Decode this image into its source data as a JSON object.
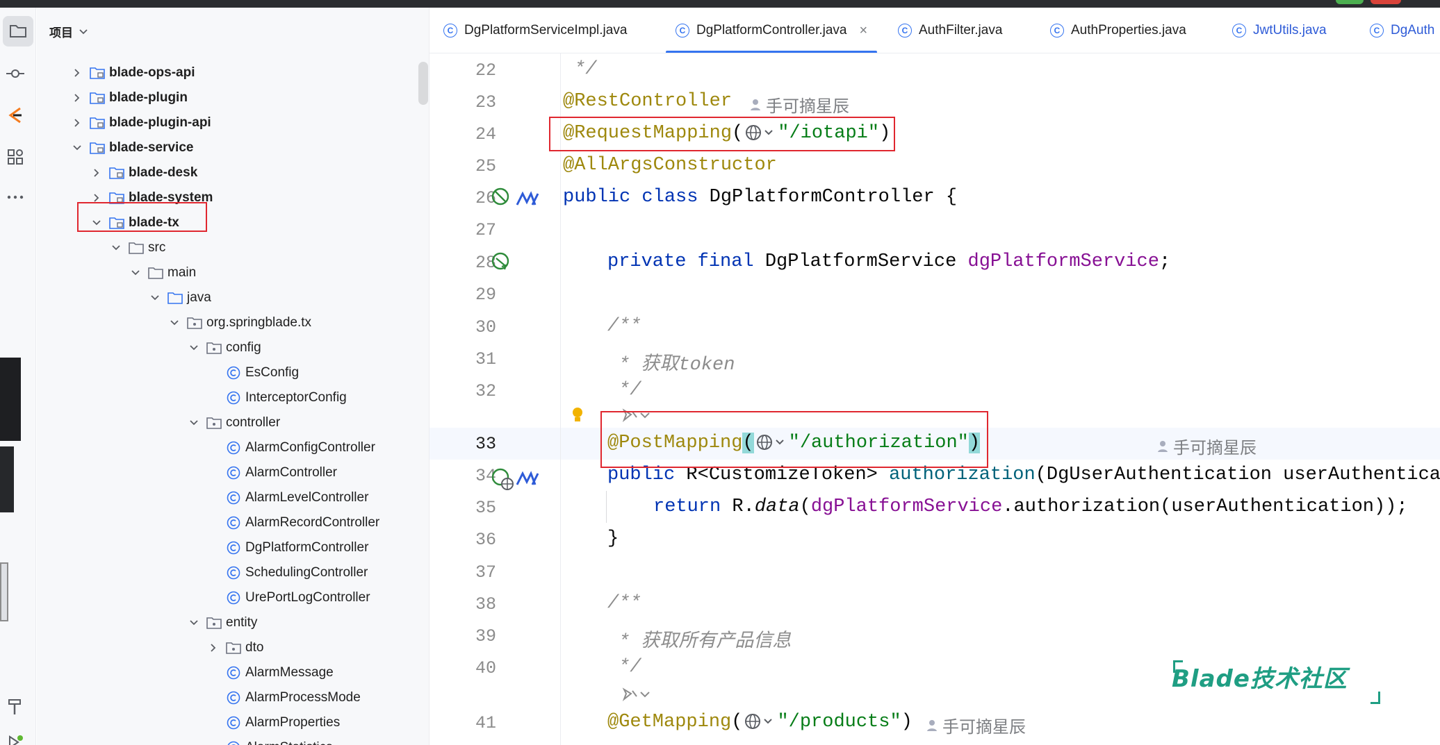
{
  "project_panel": {
    "title": "项目",
    "tree": [
      {
        "label": "blade-ops-api",
        "expanded": false,
        "icon": "module-folder-icon"
      },
      {
        "label": "blade-plugin",
        "expanded": false,
        "icon": "module-folder-icon"
      },
      {
        "label": "blade-plugin-api",
        "expanded": false,
        "icon": "module-folder-icon"
      },
      {
        "label": "blade-service",
        "expanded": true,
        "icon": "module-folder-icon"
      },
      {
        "label": "blade-desk",
        "expanded": false,
        "icon": "module-folder-icon"
      },
      {
        "label": "blade-system",
        "expanded": false,
        "icon": "module-folder-icon"
      },
      {
        "label": "blade-tx",
        "expanded": true,
        "icon": "module-folder-icon"
      },
      {
        "label": "src",
        "expanded": true,
        "icon": "folder-icon"
      },
      {
        "label": "main",
        "expanded": true,
        "icon": "folder-icon"
      },
      {
        "label": "java",
        "expanded": true,
        "icon": "source-folder-icon"
      },
      {
        "label": "org.springblade.tx",
        "expanded": true,
        "icon": "package-icon"
      },
      {
        "label": "config",
        "expanded": true,
        "icon": "package-icon"
      },
      {
        "label": "EsConfig",
        "icon": "class-icon"
      },
      {
        "label": "InterceptorConfig",
        "icon": "class-icon"
      },
      {
        "label": "controller",
        "expanded": true,
        "icon": "package-icon"
      },
      {
        "label": "AlarmConfigController",
        "icon": "class-icon"
      },
      {
        "label": "AlarmController",
        "icon": "class-icon"
      },
      {
        "label": "AlarmLevelController",
        "icon": "class-icon"
      },
      {
        "label": "AlarmRecordController",
        "icon": "class-icon"
      },
      {
        "label": "DgPlatformController",
        "icon": "class-icon"
      },
      {
        "label": "SchedulingController",
        "icon": "class-icon"
      },
      {
        "label": "UrePortLogController",
        "icon": "class-icon"
      },
      {
        "label": "entity",
        "expanded": true,
        "icon": "package-icon"
      },
      {
        "label": "dto",
        "expanded": false,
        "icon": "package-icon"
      },
      {
        "label": "AlarmMessage",
        "icon": "class-icon"
      },
      {
        "label": "AlarmProcessMode",
        "icon": "class-icon"
      },
      {
        "label": "AlarmProperties",
        "icon": "class-icon"
      },
      {
        "label": "AlarmStatistics",
        "icon": "class-icon"
      }
    ]
  },
  "tabs": [
    {
      "label": "DgPlatformServiceImpl.java",
      "active": false
    },
    {
      "label": "DgPlatformController.java",
      "active": true
    },
    {
      "label": "AuthFilter.java",
      "active": false
    },
    {
      "label": "AuthProperties.java",
      "active": false
    },
    {
      "label": "JwtUtils.java",
      "active": false
    },
    {
      "label": "DgAuth",
      "active": false
    }
  ],
  "tab_close": "×",
  "editor": {
    "line_numbers": [
      "22",
      "23",
      "24",
      "25",
      "26",
      "27",
      "28",
      "29",
      "30",
      "31",
      "32",
      "33",
      "34",
      "35",
      "36",
      "37",
      "38",
      "39",
      "40",
      "41"
    ],
    "current_line": "33",
    "author": "手可摘星辰",
    "lines": {
      "l22": "*/",
      "l23": "@RestController",
      "l24_ann": "@RequestMapping",
      "l24_str": "\"/iotapi\"",
      "l25": "@AllArgsConstructor",
      "l26_kw": "public class",
      "l26_rest": " DgPlatformController {",
      "l28_kw": "private final",
      "l28_type": " DgPlatformService ",
      "l28_field": "dgPlatformService",
      "l28_end": ";",
      "l30": "/**",
      "l31_star": "* ",
      "l31_text": "获取token",
      "l32": "*/",
      "l33_ann": "@PostMapping",
      "l33_str": "\"/authorization\"",
      "l34_kw": "public",
      "l34_type": " R<CustomizeToken> ",
      "l34_method": "authorization",
      "l34_rest": "(DgUserAuthentication userAuthenticat",
      "l35_kw": "return",
      "l35_r": " R.",
      "l35_data": "data",
      "l35_field": "dgPlatformService",
      "l35_rest": ".authorization(userAuthentication));",
      "l36": "}",
      "l38": "/**",
      "l39_star": "* ",
      "l39_text": "获取所有产品信息",
      "l40": "*/",
      "l41_ann": "@GetMapping",
      "l41_str": "\"/products\""
    }
  },
  "watermark": "Blade技术社区",
  "colors": {
    "keyword": "#0033b3",
    "annotation": "#9e880d",
    "string": "#067d17",
    "comment": "#8c8c8c",
    "field": "#871094",
    "highlight_box": "#e0272f",
    "accent": "#3574f0"
  }
}
